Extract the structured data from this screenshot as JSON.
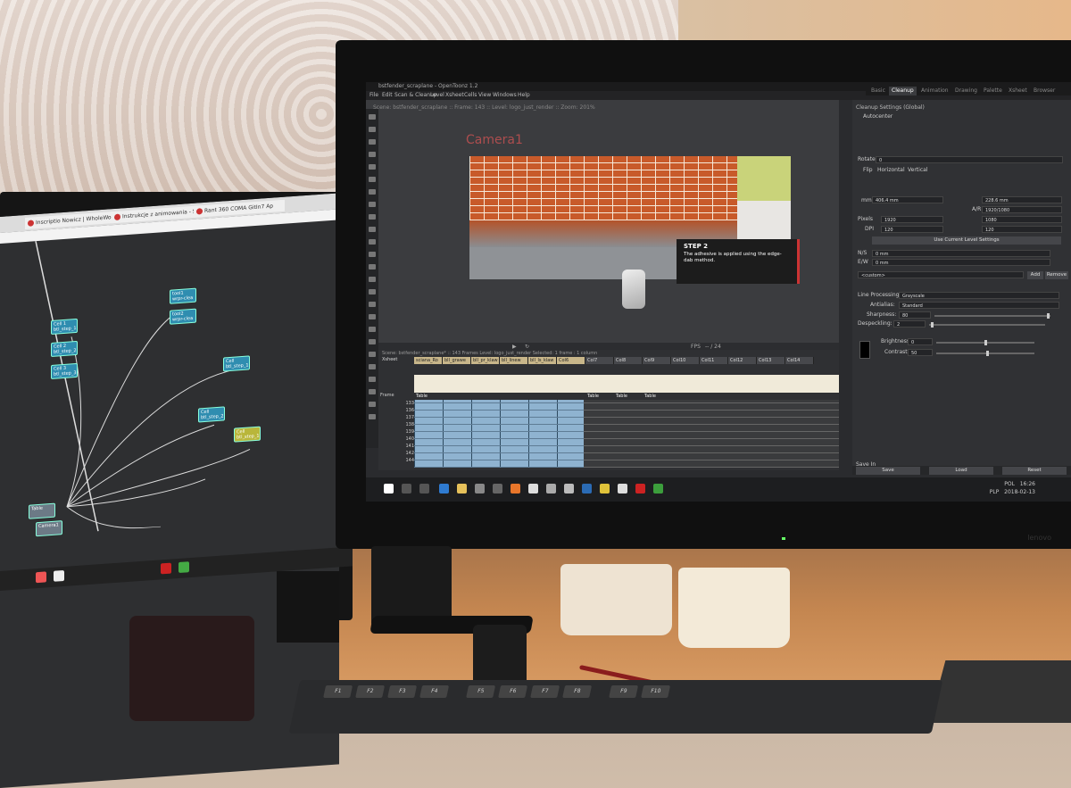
{
  "left_screen": {
    "tabs": [
      {
        "label": "Inscriptio Nowicz | WholeWorm"
      },
      {
        "label": "Instrukcje z animowania - Szcze"
      },
      {
        "label": "Rant 360 COMA GitIn7 Ap"
      }
    ],
    "nodes": [
      {
        "id": "n1",
        "label": "Cell 1 btl_step_1"
      },
      {
        "id": "n2",
        "label": "Cell 2 btl_step_2"
      },
      {
        "id": "n3",
        "label": "Cell 3 btl_step_3"
      },
      {
        "id": "n4",
        "label": "tool1 wrpr-clea"
      },
      {
        "id": "n5",
        "label": "tool2 wrpr-clea"
      },
      {
        "id": "n6",
        "label": "Cell btl_step_1"
      },
      {
        "id": "n7",
        "label": "Cell btl_step_2"
      },
      {
        "id": "n8",
        "label": "Cell btl_step_1"
      },
      {
        "id": "n9",
        "label": "Table"
      },
      {
        "id": "n10",
        "label": "Camera1"
      }
    ]
  },
  "app": {
    "title": "bstfender_scraplane - OpenToonz 1.2",
    "menu": [
      "File",
      "Edit",
      "Scan & Cleanup",
      "Level",
      "Xsheet",
      "Cells",
      "View",
      "Windows",
      "Help"
    ],
    "rooms": [
      "Basic",
      "Cleanup",
      "Animation",
      "Drawing",
      "Palette",
      "Xsheet",
      "Browser"
    ],
    "active_room": "Cleanup",
    "viewer_header": "Scene: bstfender_scraplane    ::    Frame: 143    ::    Level: logo_just_render    ::    Zoom: 201%",
    "camera_label": "Camera1",
    "step_title": "STEP 2",
    "step_text": "The adhesive is applied using the edge-dab method.",
    "fps_label": "FPS",
    "fps_value": "-- / 24",
    "frame_value": "143",
    "xsheet_header": "Scene: bstfender_scraplane*  ::  143 Frames  Level: logo_just_render  Selected: 1 frame : 1 column",
    "xsheet_label": "Xsheet",
    "xsheet_columns": [
      "sciana_Ro",
      "bll_grawe",
      "bll_pr_klaw",
      "bll_linew",
      "bll_ls_klaw",
      "Col6",
      "Col7",
      "Col8",
      "Col9",
      "Col10",
      "Col11",
      "Col12",
      "Col13",
      "Col14"
    ],
    "table_label": "Table",
    "frame_rows": [
      "133",
      "136",
      "137",
      "138",
      "139",
      "140",
      "141",
      "142",
      "144"
    ],
    "frame_label": "Frame"
  },
  "cleanup": {
    "header": "Cleanup Settings (Global)",
    "autocenter": "Autocenter",
    "rotate_label": "Rotate",
    "rotate_value": "0",
    "flip_label": "Flip",
    "flip_horizontal": "Horizontal",
    "flip_vertical": "Vertical",
    "width_unit": "mm",
    "width_value": "406.4 mm",
    "height_value": "228.6 mm",
    "ar_label": "A/R",
    "ar_value": "1920/1080",
    "pixels_label": "Pixels",
    "pixels_w": "1920",
    "pixels_h": "1080",
    "dpi_label": "DPI",
    "dpi_value": "120",
    "dpi_value2": "120",
    "use_level_settings": "Use Current Level Settings",
    "ns_label": "N/S",
    "ns_value": "0 mm",
    "ew_label": "E/W",
    "ew_value": "0 mm",
    "preset": "<custom>",
    "add": "Add",
    "remove": "Remove",
    "line_processing_label": "Line Processing:",
    "line_processing_value": "Grayscale",
    "antialias_label": "Antialias:",
    "antialias_value": "Standard",
    "sharpness_label": "Sharpness:",
    "sharpness_value": "80",
    "despeckling_label": "Despeckling:",
    "despeckling_value": "2",
    "brightness_label": "Brightness:",
    "brightness_value": "0",
    "contrast_label": "Contrast:",
    "contrast_value": "50",
    "save_in_label": "Save In",
    "save_button": "Save",
    "load_button": "Load",
    "reset_button": "Reset"
  },
  "tray": {
    "lang": "POL",
    "region": "PLP",
    "time": "16:26",
    "date": "2018-02-13"
  },
  "monitor_brand": "lenovo",
  "keyboard_keys": [
    "F1",
    "F2",
    "F3",
    "F4",
    "F5",
    "F6",
    "F7",
    "F8",
    "F9",
    "F10"
  ],
  "colors": {
    "brick": "#c85a2a",
    "xsheet_blue": "#8fb3d0",
    "step_accent": "#cc3333",
    "node_blue": "#2f8db0"
  }
}
